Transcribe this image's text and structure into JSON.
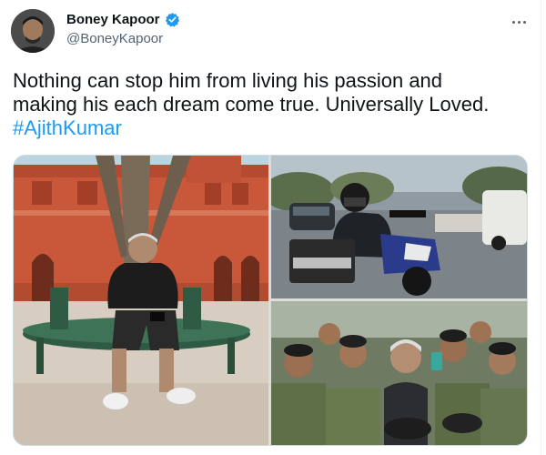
{
  "tweet": {
    "author_name": "Boney Kapoor",
    "author_handle": "@BoneyKapoor",
    "text_line1": "Nothing can stop him from living his passion and",
    "text_line2": "making his each dream come true. Universally Loved.",
    "hashtag": "#AjithKumar",
    "verified_color": "#1d9bf0"
  },
  "media": {
    "images": [
      {
        "icon": "photo-man-sitting-under-tree"
      },
      {
        "icon": "photo-man-on-motorbike"
      },
      {
        "icon": "photo-man-with-soldiers"
      }
    ]
  },
  "colors": {
    "text": "#0f1419",
    "secondary": "#536471",
    "link": "#1d9bf0"
  }
}
